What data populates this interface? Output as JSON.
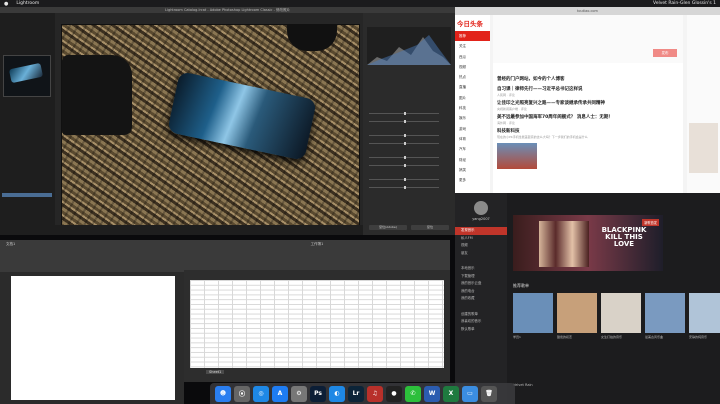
{
  "menubar": {
    "app": "Lightroom",
    "right_text": "Velvet Rain-Glen Glossin's 1"
  },
  "lightroom": {
    "title": "Lightroom Catalog.lrcat - Adobe Photoshop Lightroom Classic - 修改照片",
    "selected_folder": "",
    "btn_prev": "复位(Adobe)",
    "btn_reset": "复位",
    "histogram_label": "直方图"
  },
  "browser": {
    "tab": "toutiao.com",
    "logo": "今日头条",
    "nav": [
      "推荐",
      "关注",
      "西瓜",
      "视频",
      "热点",
      "直播",
      "图片",
      "科技",
      "娱乐",
      "游戏",
      "体育",
      "汽车",
      "财经",
      "搞笑",
      "更多"
    ],
    "nav_active_index": 0,
    "news": [
      {
        "title": "曾经的门户网站，如今的个人博客",
        "meta": ""
      },
      {
        "title": "自习课｜律师先行——习近平总书记这样说",
        "meta": "人民网 · 评论"
      },
      {
        "title": "让佳印之光照亮复兴之路——专家谈继承传承共同精神",
        "meta": "央视新闻客户端 · 评论"
      },
      {
        "title": "美不远最参加中国海军70周年阅舰式？ 消息人士：无期！",
        "meta": "海外网 · 评论"
      },
      {
        "title": "科技新科技",
        "meta": "现在的小PK手机性能差距真的这么大吗？下一步我们的手机会是什么"
      }
    ],
    "publish_btn": "发布"
  },
  "music": {
    "user": "yang2007",
    "sidebar": [
      "发现音乐",
      "私人FM",
      "视频",
      "朋友",
      "",
      "本地音乐",
      "下载管理",
      "我的音乐云盘",
      "我的电台",
      "我的收藏",
      "",
      "创建的歌单",
      "我喜欢的音乐",
      "默认歌单"
    ],
    "sidebar_active_index": 0,
    "banner_title": "BLACKPINK KILL THIS LOVE",
    "banner_tag": "新歌首发",
    "recommend_title": "推荐歌单",
    "tiles": [
      "学员1",
      "甜蜜的初恋",
      "女生打拍的音乐",
      "最美古风乐曲",
      "安静的纯音乐",
      "我的最爱"
    ],
    "now_playing": "Velvet Rain"
  },
  "excel": {
    "sheet_tab": "Sheet1",
    "title": "工作簿1"
  },
  "word": {
    "title": "文档1"
  },
  "dock": [
    {
      "name": "finder-icon",
      "glyph": "☻",
      "color": "#2a7ef0"
    },
    {
      "name": "launchpad-icon",
      "glyph": "⦿",
      "color": "#666"
    },
    {
      "name": "safari-icon",
      "glyph": "◎",
      "color": "#1e88e5"
    },
    {
      "name": "appstore-icon",
      "glyph": "A",
      "color": "#1e7cf2"
    },
    {
      "name": "settings-icon",
      "glyph": "⚙",
      "color": "#777"
    },
    {
      "name": "photoshop-icon",
      "glyph": "Ps",
      "color": "#0c1e36"
    },
    {
      "name": "app-icon",
      "glyph": "◐",
      "color": "#1e88e5"
    },
    {
      "name": "lightroom-icon",
      "glyph": "Lr",
      "color": "#0c2438"
    },
    {
      "name": "netease-icon",
      "glyph": "♫",
      "color": "#b8302a"
    },
    {
      "name": "qq-icon",
      "glyph": "●",
      "color": "#222"
    },
    {
      "name": "wechat-icon",
      "glyph": "✆",
      "color": "#2cbf3b"
    },
    {
      "name": "word-icon",
      "glyph": "W",
      "color": "#2b5cb0"
    },
    {
      "name": "excel-icon",
      "glyph": "X",
      "color": "#1f7a3f"
    },
    {
      "name": "folder-icon",
      "glyph": "▭",
      "color": "#3b8de0"
    },
    {
      "name": "trash-icon",
      "glyph": "🗑",
      "color": "#555"
    }
  ]
}
